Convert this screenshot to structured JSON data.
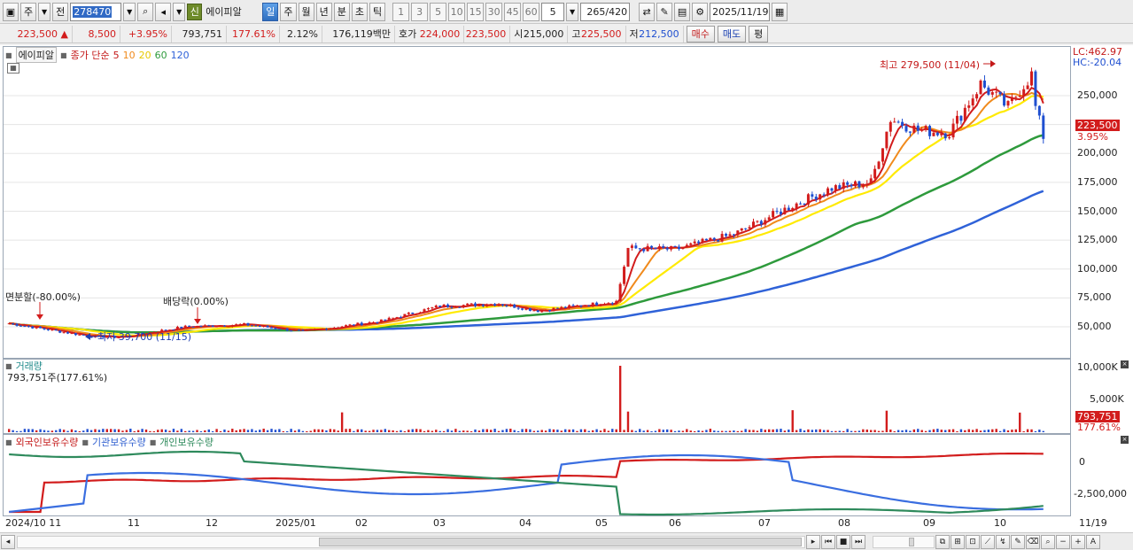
{
  "toolbar": {
    "mode_label": "주",
    "price_type": "전",
    "code": "278470",
    "new_badge": "신",
    "stock_name": "에이피알",
    "periods": [
      "일",
      "주",
      "월",
      "년",
      "분",
      "초",
      "틱"
    ],
    "active_period": "일",
    "intervals": [
      "1",
      "3",
      "5",
      "10",
      "15",
      "30",
      "45",
      "60"
    ],
    "interval_value": "5",
    "count_value": "265",
    "count_total": "/420",
    "date": "2025/11/19"
  },
  "quote": {
    "price": "223,500",
    "change": "8,500",
    "change_pct": "+3.95%",
    "volume": "793,751",
    "volume_ratio": "177.61%",
    "turnover": "2.12%",
    "amount": "176,119백만",
    "bid_label": "호가",
    "ask_price": "224,000",
    "bid_price": "223,500",
    "open_label": "시",
    "open": "215,000",
    "high_label": "고",
    "high": "225,500",
    "low_label": "저",
    "low": "212,500",
    "buy_label": "매수",
    "sell_label": "매도",
    "eval_label": "평"
  },
  "price_panel": {
    "stock_tag": "에이피알",
    "close_label": "종가 단순",
    "ma_periods": [
      "5",
      "10",
      "20",
      "60",
      "120"
    ],
    "lc_label": "LC:462.97",
    "hc_label": "HC:-20.04",
    "high_annotation": "최고 279,500 (11/04)",
    "low_annotation": "최저 39,700 (11/15)",
    "event_split": "면분할(-80.00%)",
    "event_dividend": "배당락(0.00%)",
    "current_price_tag": "223,500",
    "current_pct_tag": "3.95%",
    "y_ticks": [
      "250,000",
      "225,000",
      "200,000",
      "175,000",
      "150,000",
      "125,000",
      "100,000",
      "75,000",
      "50,000"
    ]
  },
  "volume_panel": {
    "title": "거래량",
    "value_text": "793,751주(177.61%)",
    "y_ticks": [
      "10,000K",
      "5,000K"
    ],
    "current_tag": "793,751",
    "current_pct": "177.61%"
  },
  "holdings_panel": {
    "legend": [
      "외국인보유수량",
      "기관보유수량",
      "개인보유수량"
    ],
    "y_ticks": [
      "0",
      "-2,500,000"
    ]
  },
  "x_axis": {
    "ticks": [
      "2024/10",
      "11",
      "12",
      "2025/01",
      "02",
      "03",
      "04",
      "05",
      "06",
      "07",
      "08",
      "09",
      "10",
      "11"
    ],
    "right_label": "11/19"
  },
  "colors": {
    "up": "#d21c1c",
    "down": "#1f4fd0",
    "ma5": "#d21c1c",
    "ma10": "#f08a1c",
    "ma20": "#ffea00",
    "ma60": "#2e9a3c",
    "ma120": "#2f62d8",
    "foreign": "#d21c1c",
    "institution": "#3a6ee0",
    "individual": "#2e8a5c"
  },
  "chart_data": {
    "type": "candlestick",
    "key_points": {
      "high": 279500,
      "high_date": "11/04",
      "low": 39700,
      "low_date": "11/15",
      "last_close": 223500
    },
    "ylim": [
      35000,
      290000
    ]
  }
}
